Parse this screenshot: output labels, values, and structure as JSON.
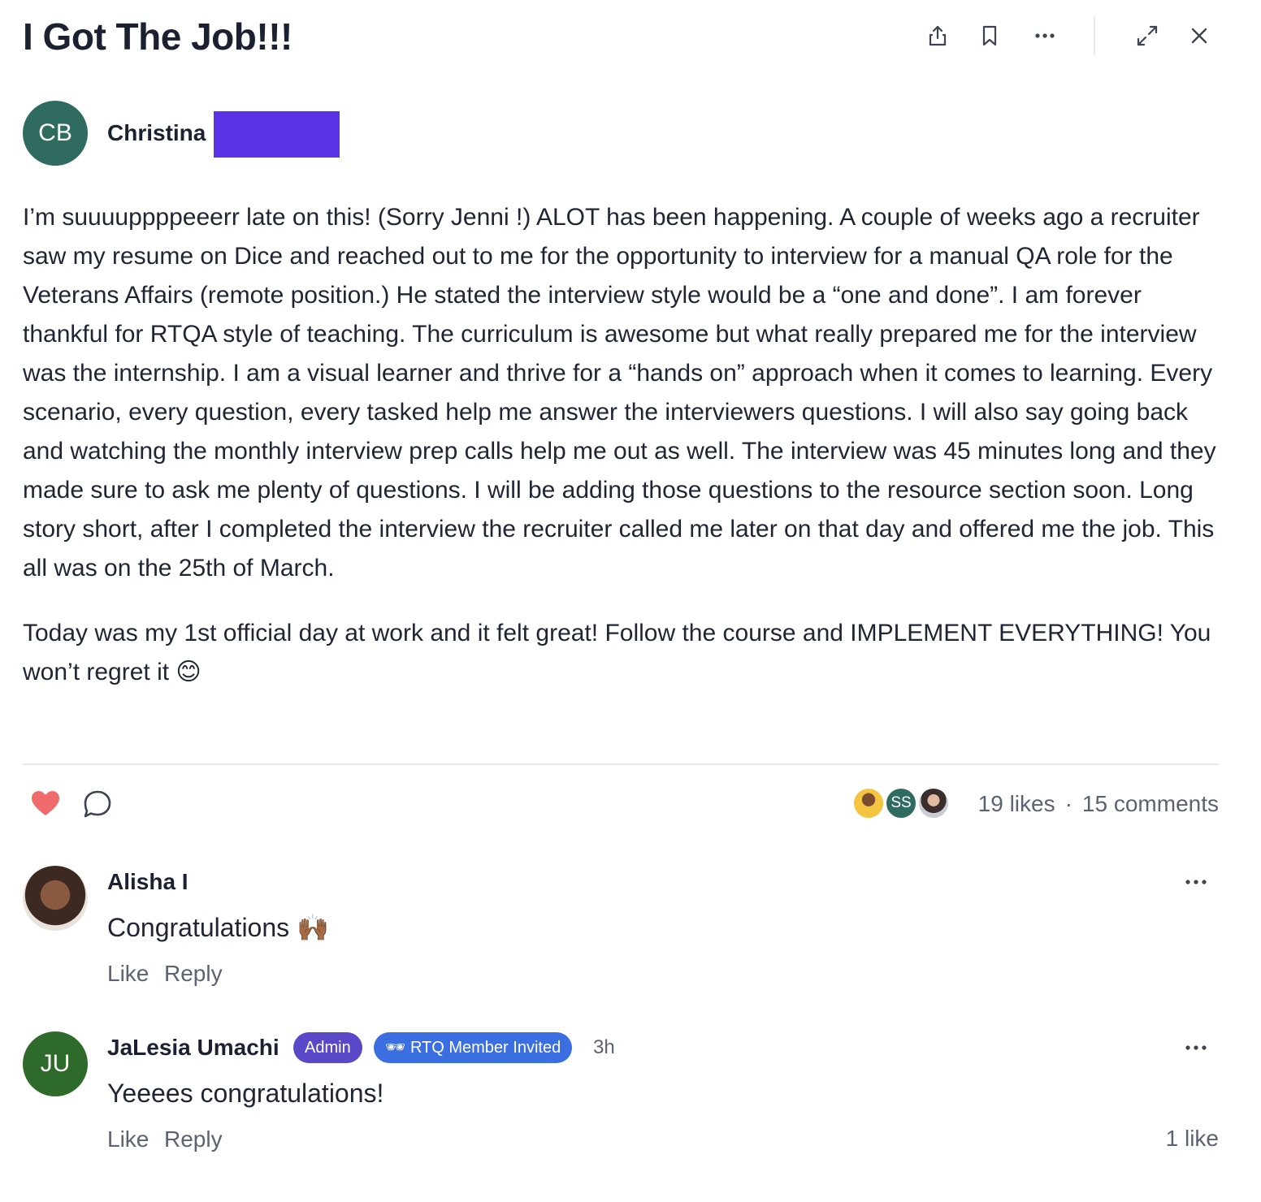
{
  "post": {
    "title": "I Got The Job!!!",
    "author_initials": "CB",
    "author_name": "Christina",
    "paragraphs": [
      "I’m suuuuppppeeerr late on this! (Sorry Jenni !) ALOT has been happening. A couple of weeks ago a recruiter saw my resume on Dice and reached out to me for the opportunity to interview for a manual QA role for the Veterans Affairs (remote position.) He stated the interview  style would be a “one and done”.  I am forever thankful for RTQA style of teaching. The curriculum is awesome but what really prepared me for the interview was the internship. I am a visual learner and thrive for a “hands on” approach when it comes to learning.  Every scenario, every question, every tasked help me answer the interviewers questions. I will also say going back and watching the monthly interview prep calls help me out as well. The interview was 45 minutes long and they made sure to ask me plenty of questions. I will be adding those questions to the resource section soon. Long story short, after I completed the interview the recruiter called me later on that day and offered me the job. This all was on the 25th of March.",
      "Today was my 1st official day at work and it felt great! Follow the course and IMPLEMENT EVERYTHING! You won’t regret it 😊"
    ],
    "likes_label": "19 likes",
    "separator": "·",
    "comments_label": "15 comments",
    "liked_by_initials": "SS"
  },
  "toolbar": {
    "icons": [
      "share-icon",
      "bookmark-icon",
      "more-icon",
      "expand-icon",
      "close-icon"
    ]
  },
  "colors": {
    "author_avatar": "#2f6b5e",
    "redaction": "#5b33e6",
    "heart": "#ef6b6b",
    "admin_badge": "#5b48c9",
    "member_badge": "#3b6ee0",
    "ju_avatar": "#2e6b2b"
  },
  "comments": [
    {
      "name": "Alisha I",
      "text": "Congratulations 🙌🏾",
      "like": "Like",
      "reply": "Reply"
    },
    {
      "initials": "JU",
      "name": "JaLesia Umachi",
      "badge_admin": "Admin",
      "badge_member": "🕶 RTQ Member Invited",
      "time": "3h",
      "text": "Yeeees congratulations!",
      "like": "Like",
      "reply": "Reply",
      "likes": "1 like"
    }
  ]
}
